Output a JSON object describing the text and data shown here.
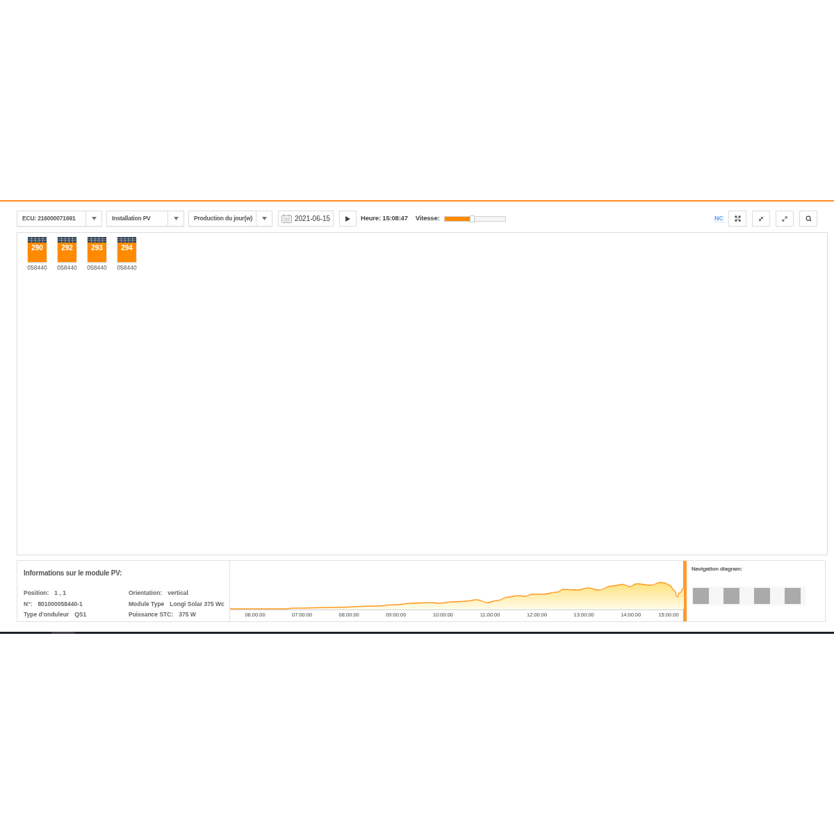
{
  "toolbar": {
    "selects": [
      {
        "value": "ECU: 216000071691"
      },
      {
        "value": "Installation PV"
      },
      {
        "value": "Production du jour(w)"
      }
    ],
    "date": "2021-06-15",
    "time": "Heure: 15:08:47",
    "speed": {
      "label": "Vitesse:",
      "level": 0.45
    },
    "link": "NC"
  },
  "modules": [
    {
      "number": "290",
      "serial": "058440"
    },
    {
      "number": "292",
      "serial": "058440"
    },
    {
      "number": "293",
      "serial": "058440"
    },
    {
      "number": "294",
      "serial": "058440"
    }
  ],
  "module_info": {
    "title": "Informations sur le module PV:",
    "columns": [
      {
        "fields": [
          {
            "label": "Position:",
            "value": "1 , 1"
          },
          {
            "label": "N°:",
            "value": "801000058440-1"
          },
          {
            "label": "Type d'onduleur",
            "value": "QS1"
          }
        ]
      },
      {
        "fields": [
          {
            "label": "Orientation:",
            "value": "vertical"
          },
          {
            "label": "Module Type",
            "value": "Longi Solar 375 Wc"
          },
          {
            "label": "Puissance STC:",
            "value": "375 W"
          }
        ]
      }
    ]
  },
  "chart": {
    "time_labels": [
      "06:00:00",
      "07:00:00",
      "08:00:00",
      "09:00:00",
      "10:00:00",
      "11:00:00",
      "12:00:00",
      "13:00:00",
      "14:00:00",
      "15:00:00"
    ]
  },
  "navigation": {
    "title": "Navigation diagram:"
  }
}
